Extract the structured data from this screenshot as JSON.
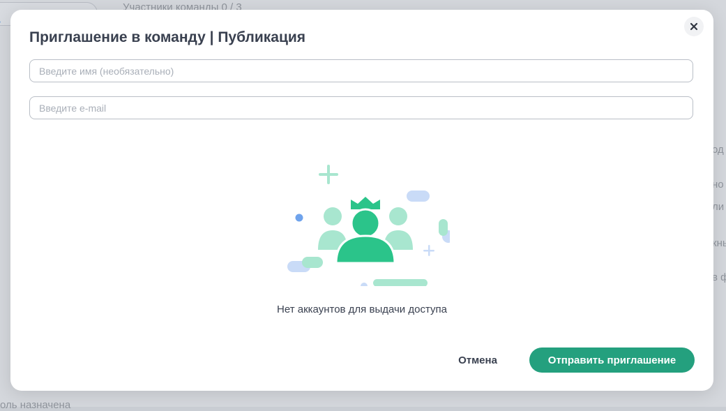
{
  "background": {
    "team_members_label": "Участники команды 0 / 3",
    "bottom_label": "оль назначена",
    "side_fragments": [
      "од",
      "но",
      "ли",
      "кны",
      "в ф"
    ]
  },
  "modal": {
    "title": "Приглашение в команду | Публикация",
    "name_placeholder": "Введите имя (необязательно)",
    "email_placeholder": "Введите e-mail",
    "empty_state_text": "Нет аккаунтов для выдачи доступа",
    "cancel_label": "Отмена",
    "send_label": "Отправить приглашение",
    "close_icon": "close-icon"
  },
  "colors": {
    "accent": "#24a07e",
    "illustration_green": "#2bc48a",
    "illustration_light_green": "#a8e6cf",
    "illustration_blue": "#c9dbf7"
  }
}
